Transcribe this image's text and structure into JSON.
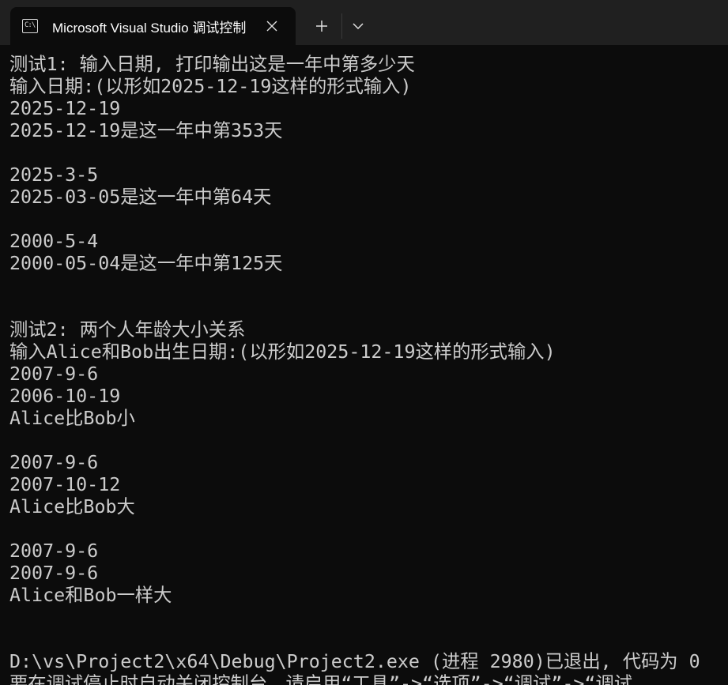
{
  "tab": {
    "icon_text": "C:\\",
    "icon": "console-app-icon",
    "title": "Microsoft Visual Studio 调试控制台",
    "close_icon": "close-icon"
  },
  "toolbar": {
    "new_tab_icon": "plus-icon",
    "dropdown_icon": "chevron-down-icon"
  },
  "colors": {
    "background": "#0c0c0c",
    "tabbar": "#202020",
    "text": "#cccccc"
  },
  "console": {
    "lines": [
      "测试1: 输入日期, 打印输出这是一年中第多少天",
      "输入日期:(以形如2025-12-19这样的形式输入)",
      "2025-12-19",
      "2025-12-19是这一年中第353天",
      "",
      "2025-3-5",
      "2025-03-05是这一年中第64天",
      "",
      "2000-5-4",
      "2000-05-04是这一年中第125天",
      "",
      "",
      "测试2: 两个人年龄大小关系",
      "输入Alice和Bob出生日期:(以形如2025-12-19这样的形式输入)",
      "2007-9-6",
      "2006-10-19",
      "Alice比Bob小",
      "",
      "2007-9-6",
      "2007-10-12",
      "Alice比Bob大",
      "",
      "2007-9-6",
      "2007-9-6",
      "Alice和Bob一样大",
      "",
      "",
      "D:\\vs\\Project2\\x64\\Debug\\Project2.exe (进程 2980)已退出, 代码为 0",
      "要在调试停止时自动关闭控制台，请启用“工具”->“选项”->“调试”->“调试"
    ]
  }
}
